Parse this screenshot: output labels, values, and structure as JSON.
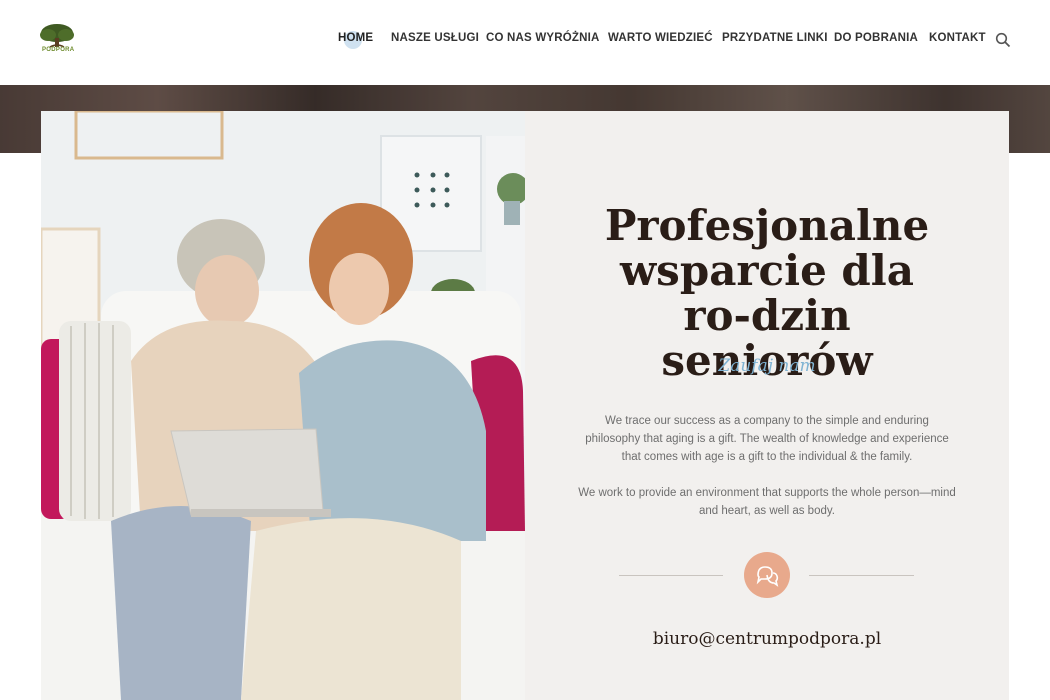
{
  "header": {
    "logo_text": "PODPORA",
    "nav": [
      {
        "label": "HOME",
        "active": true
      },
      {
        "label": "NASZE USŁUGI"
      },
      {
        "label": "CO NAS WYRÓŻNIA"
      },
      {
        "label": "WARTO WIEDZIEĆ"
      },
      {
        "label": "PRZYDATNE LINKI"
      },
      {
        "label": "DO POBRANIA"
      },
      {
        "label": "KONTAKT"
      }
    ],
    "search_icon": "search-icon"
  },
  "hero": {
    "headline": "Profesjonalne wsparcie dla ro-dzin seniorów",
    "tagline": "Zaufaj nam",
    "paragraph1": "We trace our success as a company to the simple and enduring philosophy that aging is a gift. The wealth of knowledge and experience that comes with age is a gift to the individual & the family.",
    "paragraph2": "We work to provide an environment that supports the whole person—mind and heart, as well as body.",
    "chat_icon": "chat-bubbles-icon",
    "email": "biuro@centrumpodpora.pl"
  },
  "colors": {
    "accent": "#e8a98c",
    "tagline": "#7fb3d3",
    "headline": "#2a1d17",
    "panel_bg": "#f2f0ee"
  }
}
